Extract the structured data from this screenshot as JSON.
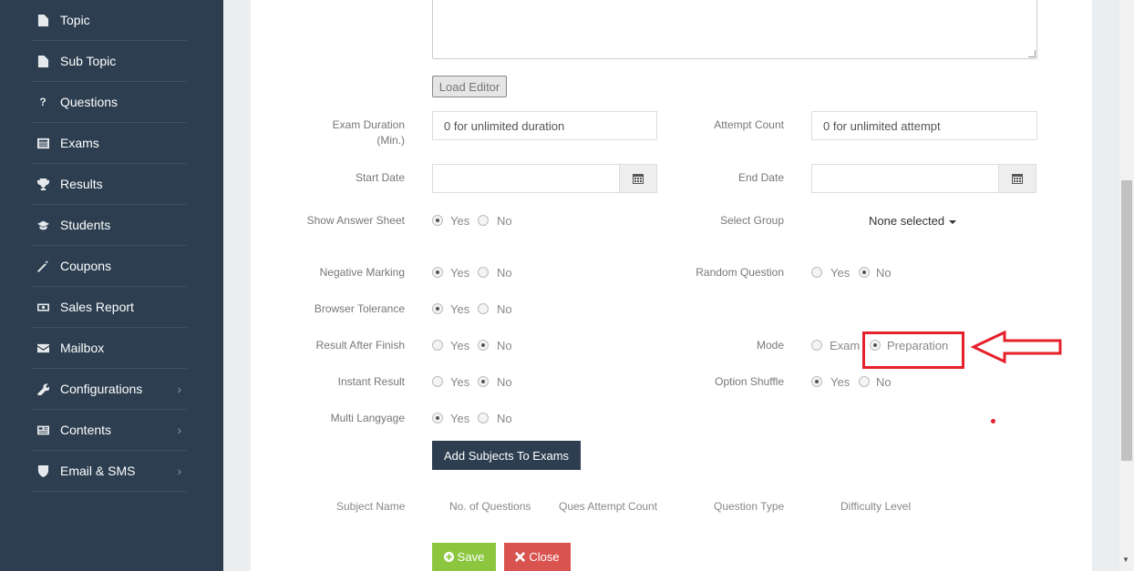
{
  "sidebar": {
    "items": [
      {
        "label": "Topic",
        "icon": "file-icon",
        "has_submenu": false
      },
      {
        "label": "Sub Topic",
        "icon": "file-icon",
        "has_submenu": false
      },
      {
        "label": "Questions",
        "icon": "question-icon",
        "has_submenu": false
      },
      {
        "label": "Exams",
        "icon": "list-icon",
        "has_submenu": false
      },
      {
        "label": "Results",
        "icon": "trophy-icon",
        "has_submenu": false
      },
      {
        "label": "Students",
        "icon": "graduation-cap-icon",
        "has_submenu": false
      },
      {
        "label": "Coupons",
        "icon": "magic-wand-icon",
        "has_submenu": false
      },
      {
        "label": "Sales Report",
        "icon": "money-icon",
        "has_submenu": false
      },
      {
        "label": "Mailbox",
        "icon": "envelope-icon",
        "has_submenu": false
      },
      {
        "label": "Configurations",
        "icon": "wrench-icon",
        "has_submenu": true
      },
      {
        "label": "Contents",
        "icon": "newspaper-icon",
        "has_submenu": true
      },
      {
        "label": "Email & SMS",
        "icon": "shield-icon",
        "has_submenu": true
      }
    ],
    "chevron": "›",
    "active": "Exams"
  },
  "form": {
    "load_editor": "Load Editor",
    "exam_duration": {
      "label_line1": "Exam Duration",
      "label_line2": "(Min.)",
      "placeholder": "0 for unlimited duration"
    },
    "attempt_count": {
      "label": "Attempt Count",
      "placeholder": "0 for unlimited attempt"
    },
    "start_date": {
      "label": "Start Date",
      "value": ""
    },
    "end_date": {
      "label": "End Date",
      "value": ""
    },
    "show_answer_sheet": {
      "label": "Show Answer Sheet",
      "options": [
        "Yes",
        "No"
      ],
      "selected": "Yes"
    },
    "select_group": {
      "label": "Select Group",
      "value": "None selected"
    },
    "negative_marking": {
      "label": "Negative Marking",
      "options": [
        "Yes",
        "No"
      ],
      "selected": "Yes"
    },
    "random_question": {
      "label": "Random Question",
      "options": [
        "Yes",
        "No"
      ],
      "selected": "No"
    },
    "browser_tolerance": {
      "label": "Browser Tolerance",
      "options": [
        "Yes",
        "No"
      ],
      "selected": "Yes"
    },
    "result_after_finish": {
      "label": "Result After Finish",
      "options": [
        "Yes",
        "No"
      ],
      "selected": "No"
    },
    "mode": {
      "label": "Mode",
      "options": [
        "Exam",
        "Preparation"
      ],
      "selected": "Preparation"
    },
    "instant_result": {
      "label": "Instant Result",
      "options": [
        "Yes",
        "No"
      ],
      "selected": "No"
    },
    "option_shuffle": {
      "label": "Option Shuffle",
      "options": [
        "Yes",
        "No"
      ],
      "selected": "Yes"
    },
    "multi_language": {
      "label": "Multi Langyage",
      "options": [
        "Yes",
        "No"
      ],
      "selected": "Yes"
    },
    "add_subjects": "Add Subjects To Exams",
    "subject_table_headers": [
      "Subject Name",
      "No. of Questions",
      "Ques Attempt Count",
      "Question Type",
      "Difficulty Level"
    ],
    "save": "Save",
    "close": "Close"
  },
  "colors": {
    "sidebar_bg": "#2c3e50",
    "save_green": "#8cc63f",
    "close_red": "#d9534f",
    "annotation_red": "#e5202a"
  }
}
